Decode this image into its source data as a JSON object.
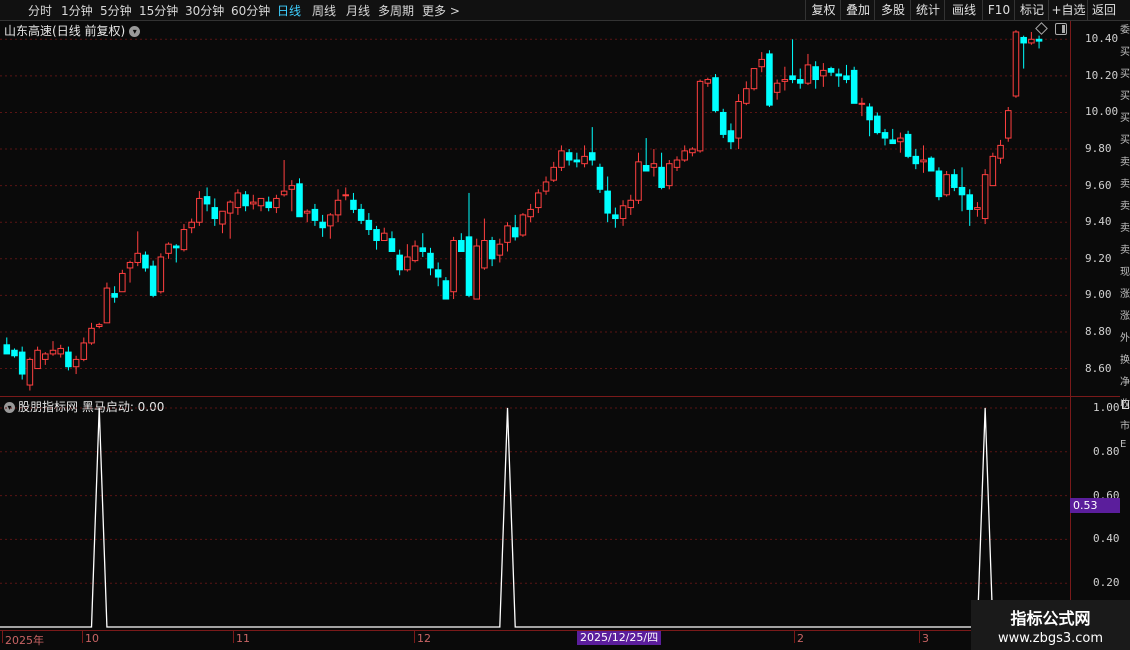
{
  "toolbar": {
    "periods": [
      "分时",
      "1分钟",
      "5分钟",
      "15分钟",
      "30分钟",
      "60分钟",
      "日线",
      "周线",
      "月线",
      "多周期",
      "更多 >"
    ],
    "active_period": "日线",
    "right_tools": [
      "复权",
      "叠加",
      "多股",
      "统计",
      "画线",
      "F10",
      "标记",
      "+自选",
      "返回"
    ]
  },
  "chart_title": {
    "name": "山东高速",
    "mode": "(日线 前复权)"
  },
  "indicator_title": "股朋指标网  黑马启动: 0.00",
  "current_value_badge": "0.53",
  "cursor_date": "2025/12/25/四",
  "right_strip_glyphs": [
    "委",
    "买",
    "买",
    "买",
    "买",
    "买",
    "卖",
    "卖",
    "卖",
    "卖",
    "卖",
    "现",
    "涨",
    "涨",
    "外",
    "换",
    "净",
    "收",
    "市",
    "E"
  ],
  "watermark": {
    "line1": "指标公式网",
    "line2": "www.zbgs3.com"
  },
  "colors": {
    "up": "#ff4040",
    "down": "#00ffff",
    "grid": "#5a1414",
    "line": "#ffffff",
    "accent": "#3fd0ff",
    "badge": "#5b1e9c"
  },
  "chart_data": [
    {
      "type": "candlestick",
      "title": "山东高速 (日线 前复权)",
      "y_ticks": [
        "10.40",
        "10.20",
        "10.00",
        "9.80",
        "9.60",
        "9.40",
        "9.20",
        "9.00",
        "8.80",
        "8.60"
      ],
      "ylim": [
        8.45,
        10.5
      ],
      "x_labels": [
        "2025年",
        "10",
        "11",
        "12",
        "2025/12/25/四",
        "2",
        "3"
      ],
      "bars_ohlc": [
        [
          8.73,
          8.77,
          8.69,
          8.68
        ],
        [
          8.7,
          8.71,
          8.66,
          8.67
        ],
        [
          8.69,
          8.72,
          8.54,
          8.57
        ],
        [
          8.51,
          8.66,
          8.48,
          8.65
        ],
        [
          8.6,
          8.72,
          8.6,
          8.7
        ],
        [
          8.65,
          8.69,
          8.62,
          8.68
        ],
        [
          8.68,
          8.75,
          8.67,
          8.7
        ],
        [
          8.68,
          8.73,
          8.66,
          8.71
        ],
        [
          8.69,
          8.72,
          8.59,
          8.61
        ],
        [
          8.61,
          8.67,
          8.57,
          8.65
        ],
        [
          8.65,
          8.77,
          8.64,
          8.74
        ],
        [
          8.74,
          8.85,
          8.73,
          8.82
        ],
        [
          8.83,
          8.85,
          8.82,
          8.84
        ],
        [
          8.85,
          9.07,
          8.85,
          9.04
        ],
        [
          9.01,
          9.05,
          8.96,
          8.99
        ],
        [
          9.02,
          9.14,
          9.02,
          9.12
        ],
        [
          9.15,
          9.19,
          9.07,
          9.18
        ],
        [
          9.18,
          9.35,
          9.16,
          9.23
        ],
        [
          9.22,
          9.24,
          9.13,
          9.15
        ],
        [
          9.16,
          9.19,
          8.99,
          9.0
        ],
        [
          9.02,
          9.23,
          9.01,
          9.21
        ],
        [
          9.23,
          9.29,
          9.2,
          9.28
        ],
        [
          9.27,
          9.28,
          9.18,
          9.26
        ],
        [
          9.25,
          9.39,
          9.24,
          9.36
        ],
        [
          9.37,
          9.42,
          9.34,
          9.4
        ],
        [
          9.4,
          9.57,
          9.38,
          9.53
        ],
        [
          9.54,
          9.59,
          9.46,
          9.5
        ],
        [
          9.48,
          9.53,
          9.38,
          9.42
        ],
        [
          9.39,
          9.44,
          9.34,
          9.46
        ],
        [
          9.45,
          9.52,
          9.31,
          9.51
        ],
        [
          9.48,
          9.58,
          9.44,
          9.56
        ],
        [
          9.55,
          9.57,
          9.46,
          9.49
        ],
        [
          9.5,
          9.55,
          9.47,
          9.51
        ],
        [
          9.49,
          9.51,
          9.46,
          9.53
        ],
        [
          9.51,
          9.54,
          9.46,
          9.48
        ],
        [
          9.48,
          9.55,
          9.45,
          9.53
        ],
        [
          9.55,
          9.74,
          9.54,
          9.57
        ],
        [
          9.58,
          9.63,
          9.46,
          9.6
        ],
        [
          9.61,
          9.64,
          9.43,
          9.43
        ],
        [
          9.45,
          9.47,
          9.4,
          9.46
        ],
        [
          9.47,
          9.5,
          9.38,
          9.41
        ],
        [
          9.4,
          9.44,
          9.32,
          9.37
        ],
        [
          9.38,
          9.45,
          9.31,
          9.44
        ],
        [
          9.44,
          9.58,
          9.4,
          9.52
        ],
        [
          9.55,
          9.59,
          9.52,
          9.55
        ],
        [
          9.52,
          9.56,
          9.45,
          9.47
        ],
        [
          9.47,
          9.5,
          9.39,
          9.41
        ],
        [
          9.41,
          9.45,
          9.33,
          9.36
        ],
        [
          9.36,
          9.38,
          9.25,
          9.3
        ],
        [
          9.3,
          9.37,
          9.3,
          9.34
        ],
        [
          9.31,
          9.35,
          9.24,
          9.24
        ],
        [
          9.22,
          9.25,
          9.11,
          9.14
        ],
        [
          9.14,
          9.28,
          9.13,
          9.21
        ],
        [
          9.19,
          9.3,
          9.18,
          9.27
        ],
        [
          9.26,
          9.34,
          9.21,
          9.24
        ],
        [
          9.23,
          9.26,
          9.11,
          9.15
        ],
        [
          9.14,
          9.18,
          9.05,
          9.1
        ],
        [
          9.08,
          9.1,
          8.98,
          8.98
        ],
        [
          9.02,
          9.32,
          8.98,
          9.3
        ],
        [
          9.3,
          9.34,
          9.24,
          9.24
        ],
        [
          9.32,
          9.56,
          8.99,
          9.0
        ],
        [
          8.98,
          9.31,
          8.98,
          9.27
        ],
        [
          9.15,
          9.42,
          9.14,
          9.3
        ],
        [
          9.3,
          9.32,
          9.16,
          9.2
        ],
        [
          9.22,
          9.31,
          9.18,
          9.28
        ],
        [
          9.29,
          9.4,
          9.24,
          9.38
        ],
        [
          9.37,
          9.44,
          9.3,
          9.32
        ],
        [
          9.33,
          9.45,
          9.32,
          9.44
        ],
        [
          9.43,
          9.5,
          9.4,
          9.47
        ],
        [
          9.48,
          9.58,
          9.45,
          9.56
        ],
        [
          9.57,
          9.65,
          9.55,
          9.62
        ],
        [
          9.63,
          9.73,
          9.62,
          9.7
        ],
        [
          9.7,
          9.82,
          9.68,
          9.79
        ],
        [
          9.78,
          9.8,
          9.71,
          9.74
        ],
        [
          9.74,
          9.78,
          9.7,
          9.73
        ],
        [
          9.72,
          9.82,
          9.7,
          9.76
        ],
        [
          9.78,
          9.92,
          9.71,
          9.74
        ],
        [
          9.7,
          9.72,
          9.56,
          9.58
        ],
        [
          9.57,
          9.65,
          9.4,
          9.45
        ],
        [
          9.44,
          9.48,
          9.37,
          9.42
        ],
        [
          9.42,
          9.52,
          9.38,
          9.49
        ],
        [
          9.48,
          9.55,
          9.44,
          9.52
        ],
        [
          9.52,
          9.78,
          9.5,
          9.73
        ],
        [
          9.71,
          9.86,
          9.7,
          9.68
        ],
        [
          9.7,
          9.8,
          9.65,
          9.72
        ],
        [
          9.7,
          9.78,
          9.58,
          9.59
        ],
        [
          9.6,
          9.74,
          9.58,
          9.72
        ],
        [
          9.7,
          9.76,
          9.68,
          9.74
        ],
        [
          9.74,
          9.82,
          9.73,
          9.79
        ],
        [
          9.78,
          9.81,
          9.76,
          9.8
        ],
        [
          9.79,
          10.18,
          9.78,
          10.17
        ],
        [
          10.16,
          10.19,
          10.14,
          10.18
        ],
        [
          10.19,
          10.21,
          10.0,
          10.01
        ],
        [
          10.0,
          10.02,
          9.86,
          9.88
        ],
        [
          9.9,
          9.94,
          9.8,
          9.84
        ],
        [
          9.86,
          10.1,
          9.8,
          10.06
        ],
        [
          10.05,
          10.17,
          10.04,
          10.13
        ],
        [
          10.13,
          10.24,
          10.12,
          10.24
        ],
        [
          10.25,
          10.33,
          10.22,
          10.29
        ],
        [
          10.32,
          10.34,
          10.03,
          10.04
        ],
        [
          10.11,
          10.18,
          10.07,
          10.16
        ],
        [
          10.17,
          10.25,
          10.12,
          10.18
        ],
        [
          10.2,
          10.4,
          10.16,
          10.18
        ],
        [
          10.18,
          10.24,
          10.13,
          10.16
        ],
        [
          10.16,
          10.32,
          10.15,
          10.26
        ],
        [
          10.25,
          10.28,
          10.13,
          10.18
        ],
        [
          10.2,
          10.27,
          10.14,
          10.23
        ],
        [
          10.24,
          10.25,
          10.2,
          10.22
        ],
        [
          10.21,
          10.24,
          10.14,
          10.2
        ],
        [
          10.2,
          10.26,
          10.16,
          10.18
        ],
        [
          10.23,
          10.25,
          10.05,
          10.05
        ],
        [
          10.05,
          10.08,
          9.98,
          10.05
        ],
        [
          10.03,
          10.05,
          9.87,
          9.96
        ],
        [
          9.98,
          10.0,
          9.88,
          9.89
        ],
        [
          9.89,
          9.91,
          9.82,
          9.86
        ],
        [
          9.85,
          9.91,
          9.84,
          9.83
        ],
        [
          9.84,
          9.89,
          9.78,
          9.86
        ],
        [
          9.88,
          9.9,
          9.75,
          9.76
        ],
        [
          9.76,
          9.8,
          9.69,
          9.72
        ],
        [
          9.73,
          9.82,
          9.67,
          9.74
        ],
        [
          9.75,
          9.76,
          9.68,
          9.68
        ],
        [
          9.68,
          9.7,
          9.52,
          9.54
        ],
        [
          9.55,
          9.68,
          9.54,
          9.66
        ],
        [
          9.66,
          9.69,
          9.57,
          9.59
        ],
        [
          9.59,
          9.7,
          9.46,
          9.55
        ],
        [
          9.55,
          9.58,
          9.38,
          9.47
        ],
        [
          9.47,
          9.51,
          9.43,
          9.48
        ],
        [
          9.42,
          9.69,
          9.39,
          9.66
        ],
        [
          9.6,
          9.78,
          9.6,
          9.76
        ],
        [
          9.75,
          9.85,
          9.72,
          9.82
        ],
        [
          9.86,
          10.03,
          9.84,
          10.01
        ],
        [
          10.09,
          10.45,
          10.08,
          10.44
        ],
        [
          10.41,
          10.42,
          10.24,
          10.38
        ],
        [
          10.38,
          10.44,
          10.37,
          10.4
        ],
        [
          10.4,
          10.42,
          10.35,
          10.39
        ]
      ]
    },
    {
      "type": "line",
      "title": "黑马启动",
      "y_ticks": [
        "1.00",
        "0.80",
        "0.60",
        "0.40",
        "0.20"
      ],
      "ylim": [
        0,
        1.05
      ],
      "spikes_at_bar_index": [
        12,
        65,
        127
      ],
      "baseline": 0
    }
  ]
}
